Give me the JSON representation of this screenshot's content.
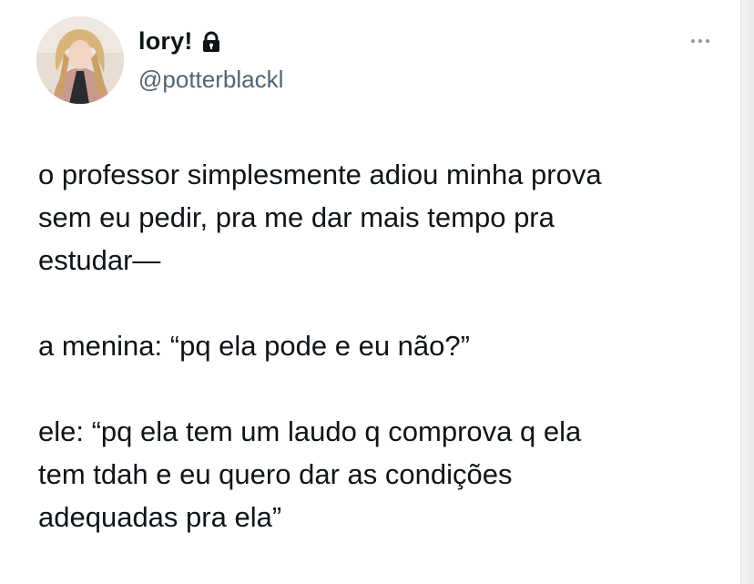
{
  "author": {
    "display_name": "lory!",
    "handle": "@potterblackl",
    "avatar_icon": "profile-photo",
    "protected_icon": "lock-icon"
  },
  "menu": {
    "more_icon": "more-horizontal-icon"
  },
  "tweet": {
    "lines": [
      "o professor simplesmente adiou minha prova",
      "sem eu pedir, pra me dar mais tempo pra",
      "estudar—",
      "a menina: “pq ela pode e eu não?”",
      "ele: “pq ela tem um laudo q comprova q ela",
      "tem tdah e eu quero dar as condições",
      "adequadas pra ela”"
    ]
  },
  "colors": {
    "text": "#0f1419",
    "secondary": "#536471",
    "background": "#ffffff"
  }
}
